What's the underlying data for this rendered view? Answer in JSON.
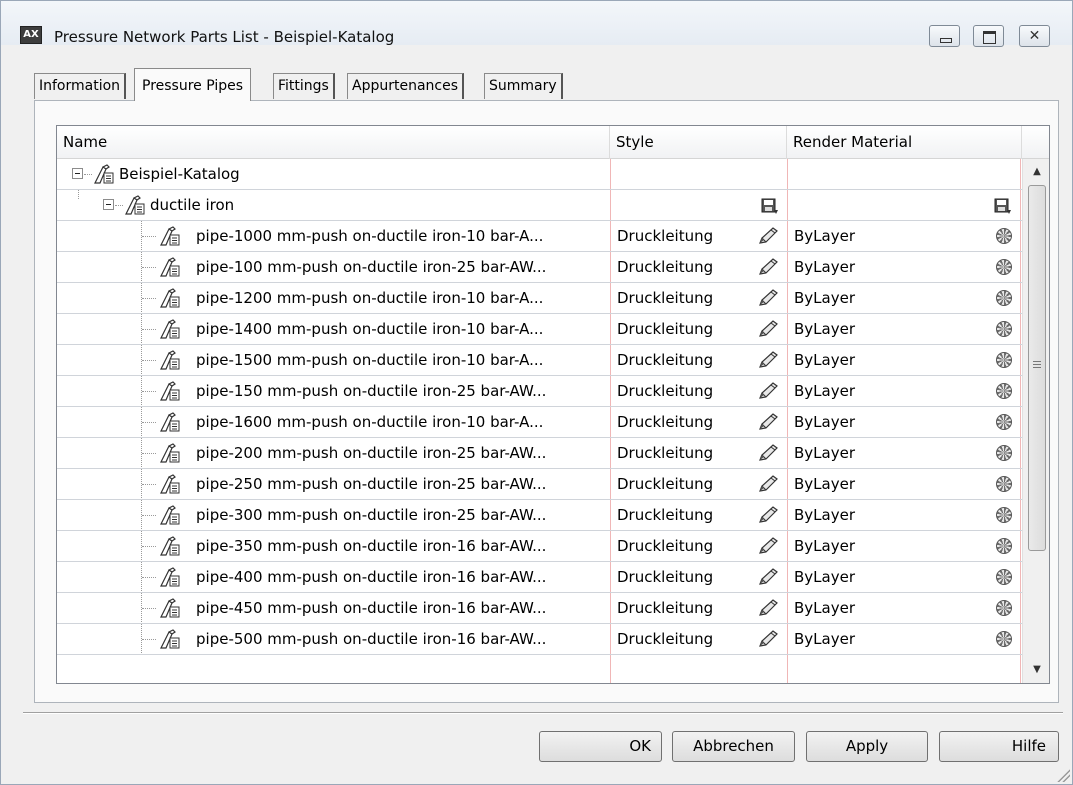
{
  "window": {
    "title": "Pressure Network Parts List - Beispiel-Katalog",
    "app_icon_label": "AX"
  },
  "tabs": [
    {
      "label": "Information",
      "active": false
    },
    {
      "label": "Pressure Pipes",
      "active": true
    },
    {
      "label": "Fittings",
      "active": false
    },
    {
      "label": "Appurtenances",
      "active": false
    },
    {
      "label": "Summary",
      "active": false
    }
  ],
  "grid": {
    "columns": [
      "Name",
      "Style",
      "Render Material"
    ],
    "root": {
      "label": "Beispiel-Katalog"
    },
    "group": {
      "label": "ductile iron"
    },
    "rows": [
      {
        "name": "pipe-1000 mm-push on-ductile iron-10 bar-A...",
        "style": "Druckleitung",
        "material": "ByLayer"
      },
      {
        "name": "pipe-100 mm-push on-ductile iron-25 bar-AW...",
        "style": "Druckleitung",
        "material": "ByLayer"
      },
      {
        "name": "pipe-1200 mm-push on-ductile iron-10 bar-A...",
        "style": "Druckleitung",
        "material": "ByLayer"
      },
      {
        "name": "pipe-1400 mm-push on-ductile iron-10 bar-A...",
        "style": "Druckleitung",
        "material": "ByLayer"
      },
      {
        "name": "pipe-1500 mm-push on-ductile iron-10 bar-A...",
        "style": "Druckleitung",
        "material": "ByLayer"
      },
      {
        "name": "pipe-150 mm-push on-ductile iron-25 bar-AW...",
        "style": "Druckleitung",
        "material": "ByLayer"
      },
      {
        "name": "pipe-1600 mm-push on-ductile iron-10 bar-A...",
        "style": "Druckleitung",
        "material": "ByLayer"
      },
      {
        "name": "pipe-200 mm-push on-ductile iron-25 bar-AW...",
        "style": "Druckleitung",
        "material": "ByLayer"
      },
      {
        "name": "pipe-250 mm-push on-ductile iron-25 bar-AW...",
        "style": "Druckleitung",
        "material": "ByLayer"
      },
      {
        "name": "pipe-300 mm-push on-ductile iron-25 bar-AW...",
        "style": "Druckleitung",
        "material": "ByLayer"
      },
      {
        "name": "pipe-350 mm-push on-ductile iron-16 bar-AW...",
        "style": "Druckleitung",
        "material": "ByLayer"
      },
      {
        "name": "pipe-400 mm-push on-ductile iron-16 bar-AW...",
        "style": "Druckleitung",
        "material": "ByLayer"
      },
      {
        "name": "pipe-450 mm-push on-ductile iron-16 bar-AW...",
        "style": "Druckleitung",
        "material": "ByLayer"
      },
      {
        "name": "pipe-500 mm-push on-ductile iron-16 bar-AW...",
        "style": "Druckleitung",
        "material": "ByLayer"
      }
    ]
  },
  "buttons": {
    "ok": "OK",
    "cancel": "Abbrechen",
    "apply": "Apply",
    "help": "Hilfe"
  },
  "colors": {
    "column_divider": "#f0b6b6",
    "row_line": "#d0d4da",
    "tree_line": "#9a9a9a"
  }
}
